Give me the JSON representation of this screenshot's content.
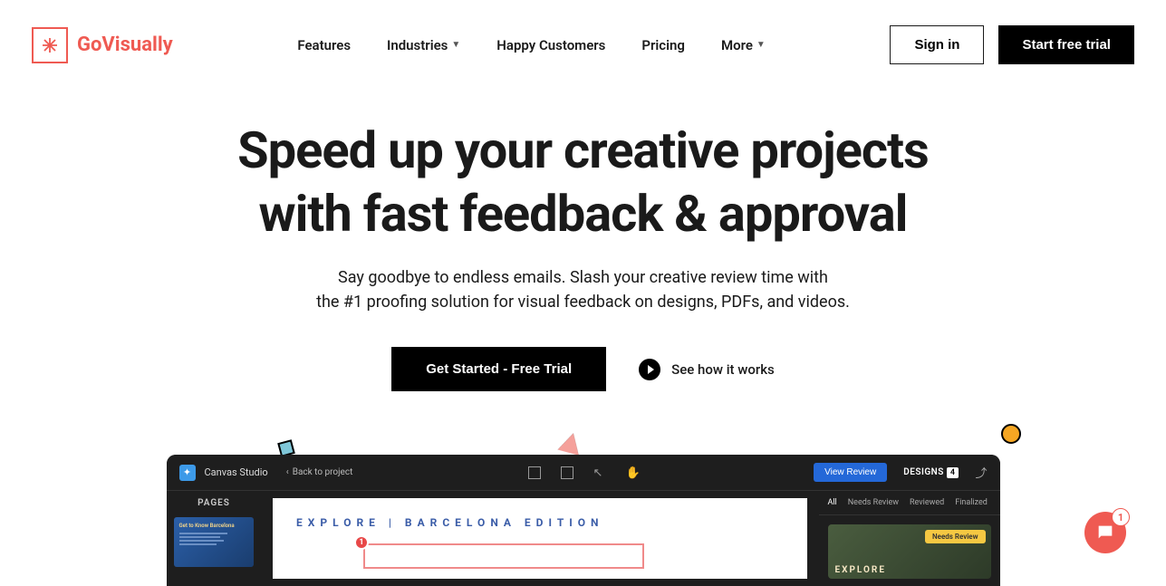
{
  "brand": {
    "name": "GoVisually"
  },
  "nav": {
    "items": [
      "Features",
      "Industries",
      "Happy Customers",
      "Pricing",
      "More"
    ],
    "dropdown_indices": [
      1,
      4
    ]
  },
  "header_actions": {
    "signin": "Sign in",
    "trial": "Start free trial"
  },
  "hero": {
    "title_line1": "Speed up your creative projects",
    "title_line2": "with fast feedback & approval",
    "sub_line1": "Say goodbye to endless emails. Slash your creative review time with",
    "sub_line2": "the #1 proofing solution for visual feedback on designs, PDFs, and videos.",
    "cta_primary": "Get Started - Free Trial",
    "cta_secondary": "See how it works"
  },
  "app": {
    "title": "Canvas Studio",
    "back": "Back to project",
    "view_review": "View Review",
    "designs_label": "DESIGNS",
    "designs_count": "4",
    "pages_label": "PAGES",
    "thumb_title": "Get to Know Barcelona",
    "canvas_heading": "EXPLORE | BARCELONA EDITION",
    "comment_pin": "1",
    "filters": [
      "All",
      "Needs Review",
      "Reviewed",
      "Finalized"
    ],
    "needs_badge": "Needs Review",
    "card_text": "EXPLORE"
  },
  "chat": {
    "badge": "1"
  }
}
